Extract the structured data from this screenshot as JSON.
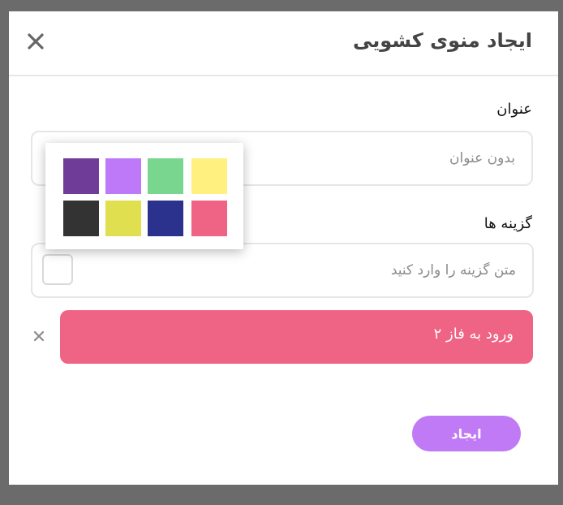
{
  "dialog": {
    "title": "ایجاد منوی کشویی",
    "title_field": {
      "label": "عنوان",
      "placeholder": "بدون عنوان",
      "value": ""
    },
    "options_field": {
      "label": "گزینه ها",
      "placeholder": "متن گزینه را وارد کنید",
      "value": ""
    },
    "options": [
      {
        "text": "ورود به فاز ۲",
        "color": "#ef6384"
      }
    ],
    "create_button": {
      "label": "ایجاد",
      "color": "#c07af5"
    }
  },
  "palette": {
    "colors": [
      "#6f3d97",
      "#bd79f7",
      "#79d68e",
      "#fff07f",
      "#333333",
      "#dfdf50",
      "#2a328e",
      "#ef6384"
    ]
  },
  "icons": [
    "close-icon",
    "remove-option-icon"
  ]
}
